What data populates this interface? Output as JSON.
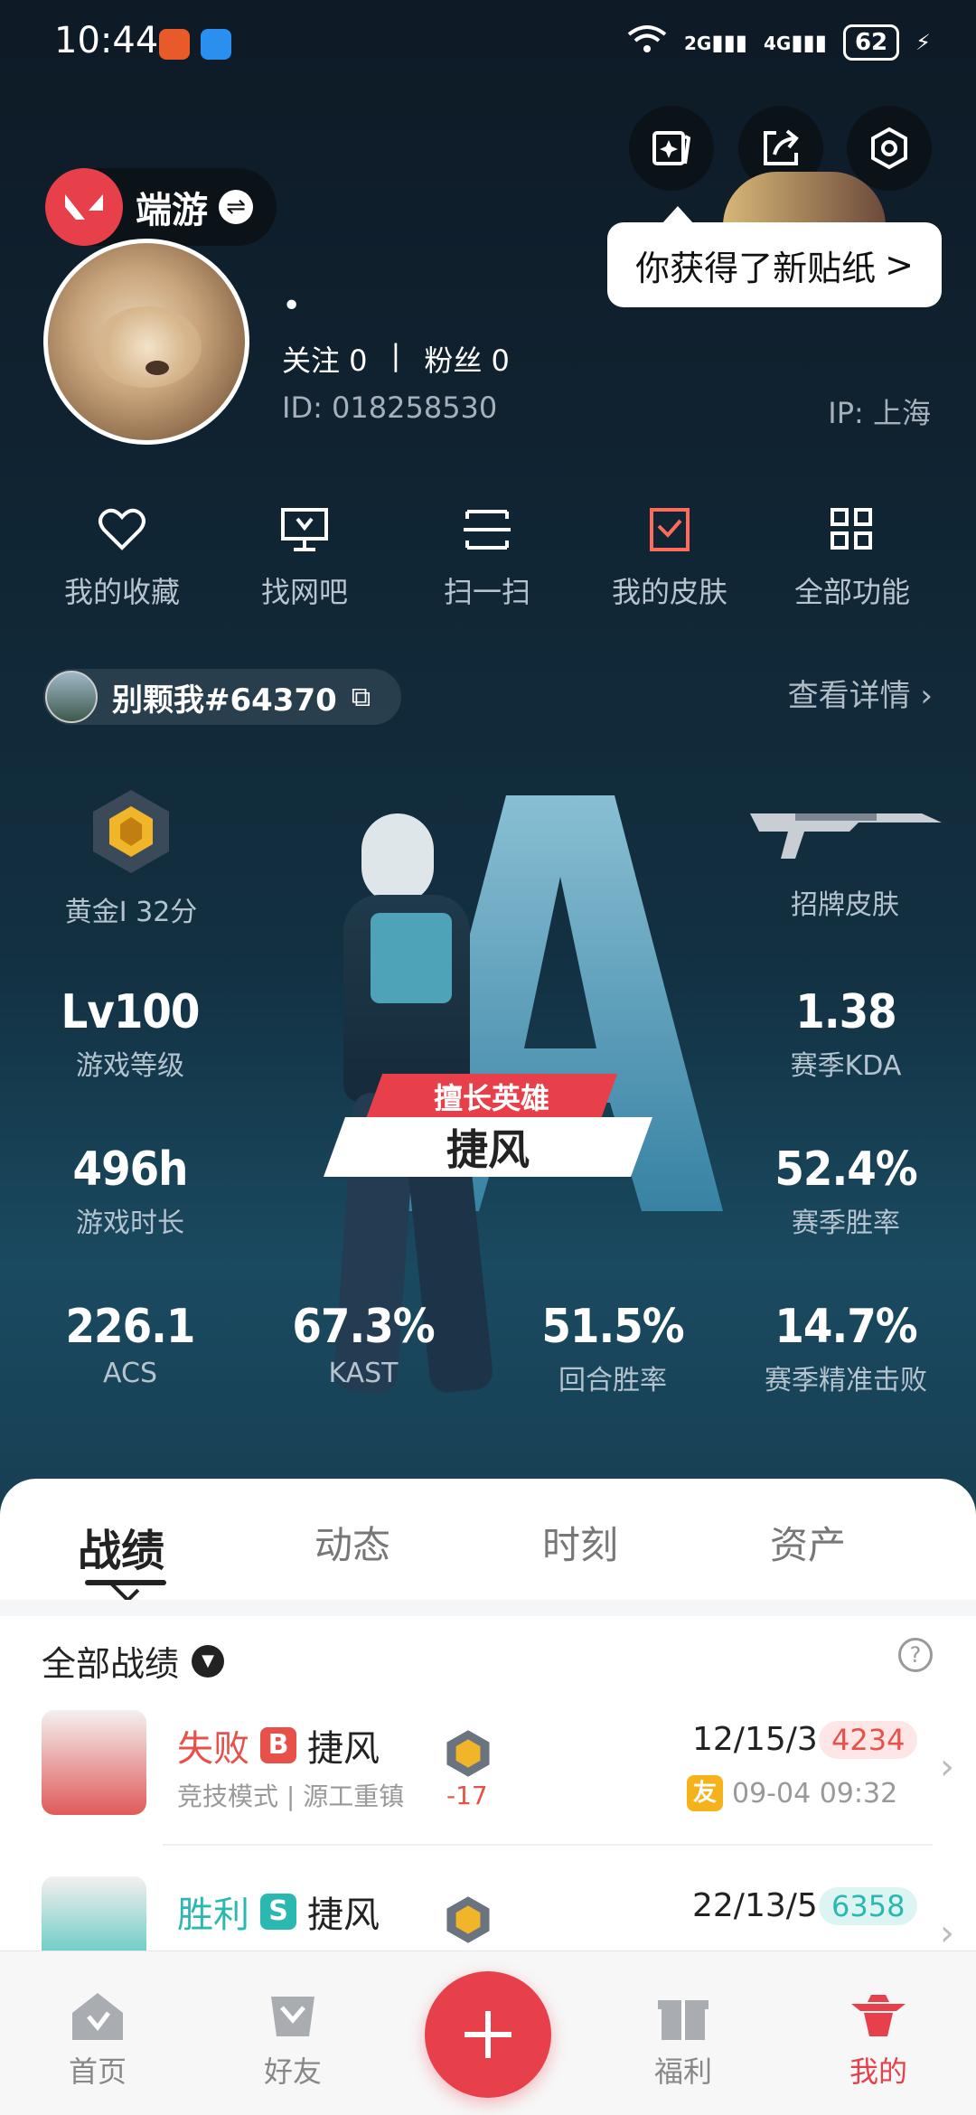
{
  "status_bar": {
    "time": "10:44",
    "signal1": "2G",
    "signal2": "4G",
    "battery": "62"
  },
  "header": {
    "sticker_tip": "你获得了新贴纸",
    "tip_arrow": ">"
  },
  "profile": {
    "app_name": "端游",
    "nickname": "•",
    "follow_label": "关注 0",
    "separator": "|",
    "fans_label": "粉丝 0",
    "id_text": "ID:  018258530",
    "ip_text": "IP:  上海"
  },
  "shortcuts": [
    {
      "label": "我的收藏",
      "icon": "heart-icon"
    },
    {
      "label": "找网吧",
      "icon": "monitor-icon"
    },
    {
      "label": "扫一扫",
      "icon": "scan-icon"
    },
    {
      "label": "我的皮肤",
      "icon": "skin-icon"
    },
    {
      "label": "全部功能",
      "icon": "grid-icon"
    }
  ],
  "game_account": {
    "name": "别颗我#64370",
    "details": "查看详情"
  },
  "game_stats": {
    "rank": "黄金I 32分",
    "skin": "招牌皮肤",
    "level": {
      "value": "Lv100",
      "label": "游戏等级"
    },
    "kda": {
      "value": "1.38",
      "label": "赛季KDA"
    },
    "hours": {
      "value": "496h",
      "label": "游戏时长"
    },
    "winrate": {
      "value": "52.4%",
      "label": "赛季胜率"
    },
    "acs": {
      "value": "226.1",
      "label": "ACS"
    },
    "kast": {
      "value": "67.3%",
      "label": "KAST"
    },
    "round_win": {
      "value": "51.5%",
      "label": "回合胜率"
    },
    "hs": {
      "value": "14.7%",
      "label": "赛季精准击败"
    },
    "best_hero_tag": "擅长英雄",
    "best_hero": "捷风"
  },
  "tabs": [
    "战绩",
    "动态",
    "时刻",
    "资产"
  ],
  "records": {
    "filter": "全部战绩",
    "items": [
      {
        "result": "失败",
        "grade": "B",
        "hero": "捷风",
        "mode": "竞技模式 | 源工重镇",
        "delta": "-17",
        "kda": "12/15/3",
        "score": "4234",
        "friend_tag": "友",
        "time": "09-04 09:32"
      },
      {
        "result": "胜利",
        "grade": "S",
        "hero": "捷风",
        "kda": "22/13/5",
        "score": "6358"
      }
    ]
  },
  "bottom_nav": [
    "首页",
    "好友",
    "福利",
    "我的"
  ],
  "colors": {
    "accent": "#e8404a",
    "win": "#2bb8b0",
    "lose": "#e8504a"
  }
}
